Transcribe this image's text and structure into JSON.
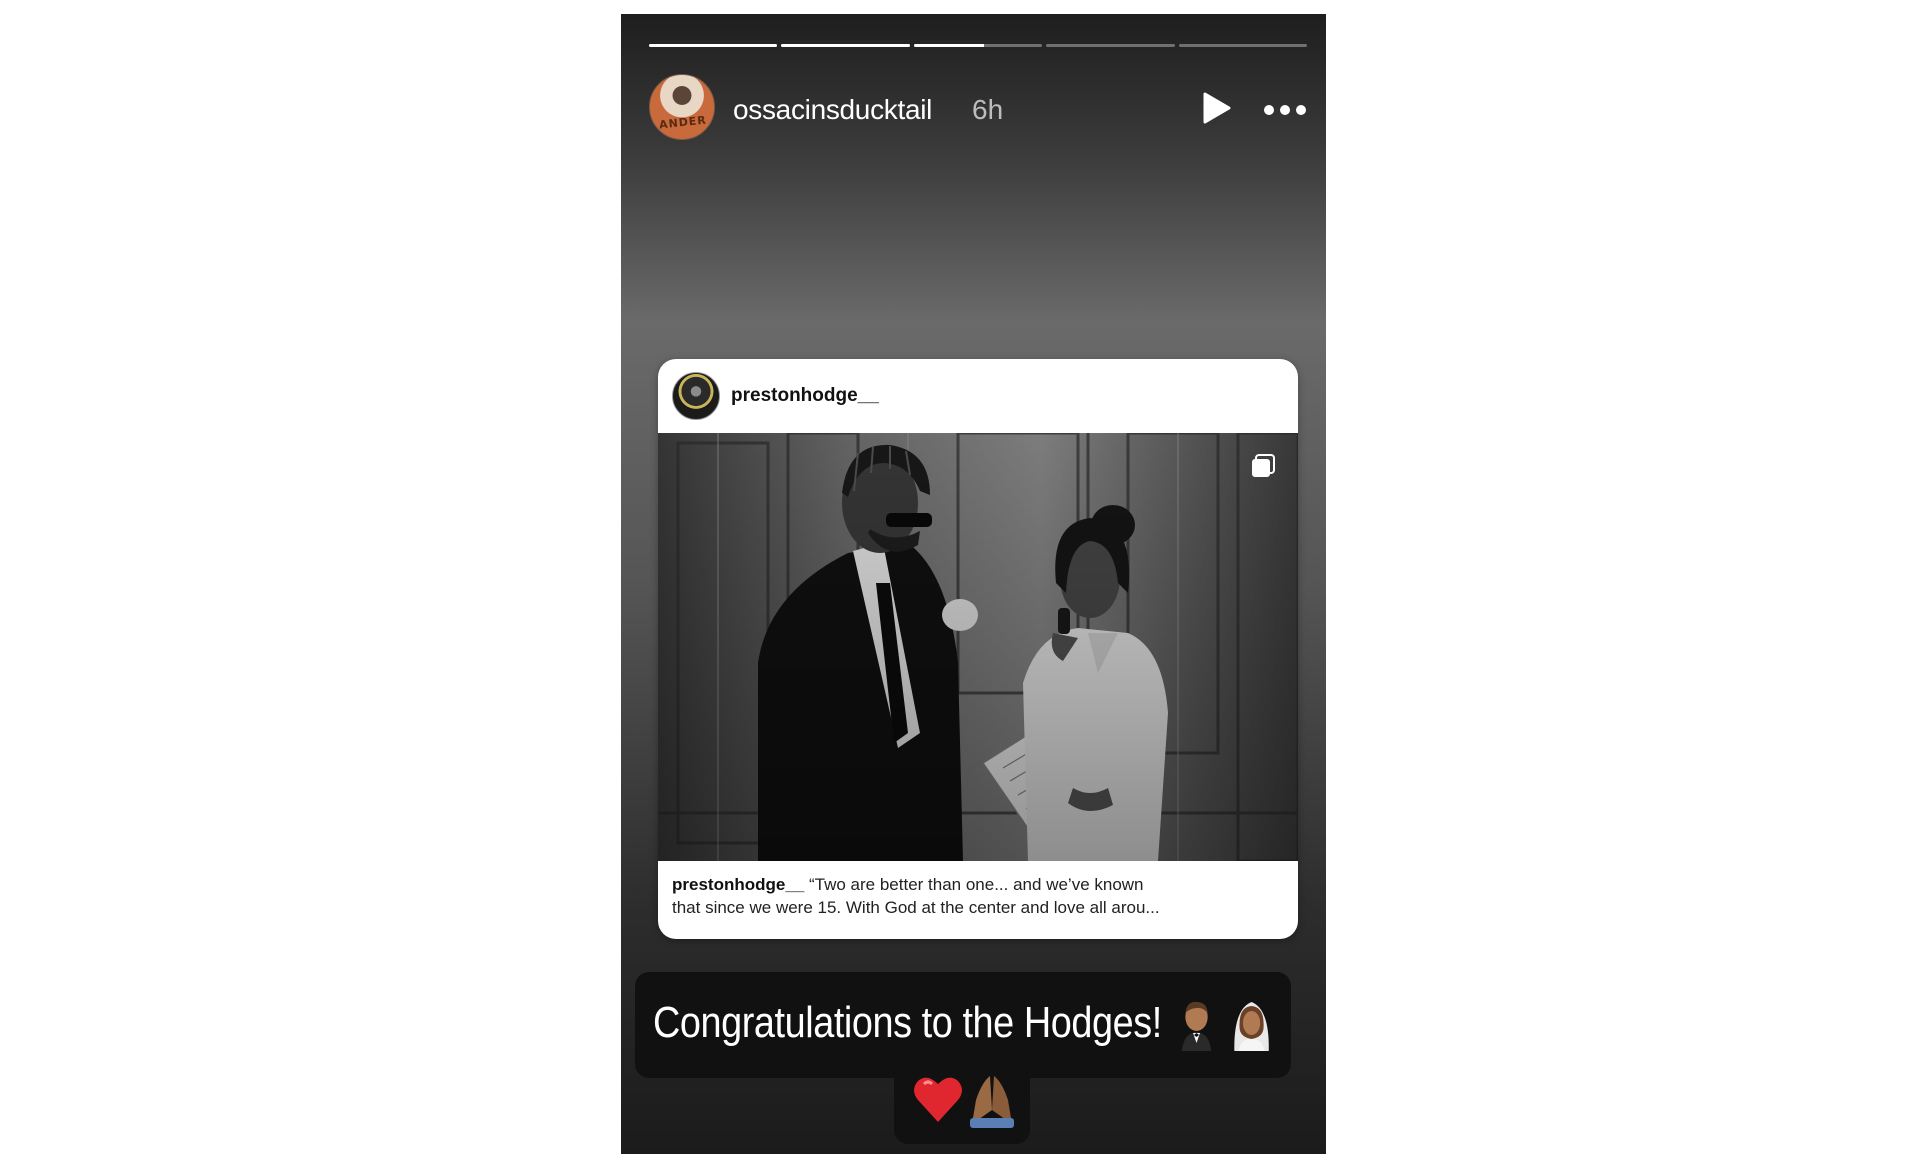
{
  "story": {
    "progress": [
      {
        "fill": 1.0
      },
      {
        "fill": 1.0
      },
      {
        "fill": 0.55
      },
      {
        "fill": 0.0
      },
      {
        "fill": 0.0
      }
    ],
    "author": {
      "username": "ossacinsducktail",
      "time_ago": "6h",
      "avatar_text": "ANDER"
    },
    "controls": {
      "play_icon": "play-icon",
      "more_icon": "more-options-icon"
    },
    "shared_post": {
      "username": "prestonhodge__",
      "caption_username": "prestonhodge__",
      "caption_line1": "“Two are better than one... and we’ve known",
      "caption_line2": "that since we were 15. With God at the center and love all arou...",
      "multi_photo_icon": "carousel-icon"
    },
    "sticker": {
      "text": "Congratulations to the Hodges!",
      "emojis": [
        "groom-emoji",
        "bride-emoji",
        "red-heart-emoji",
        "folded-hands-emoji"
      ]
    },
    "colors": {
      "card_bg": "#ffffff",
      "sticker_bg": "#111111",
      "heart": "#e0262e"
    }
  }
}
